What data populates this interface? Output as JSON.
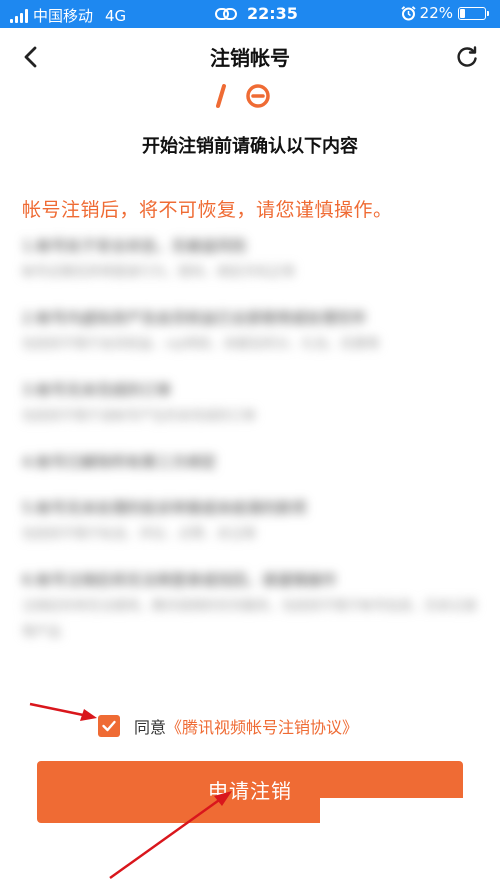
{
  "status_bar": {
    "carrier": "中国移动",
    "network": "4G",
    "time": "22:35",
    "battery_pct": "22%",
    "battery_level": 0.22
  },
  "nav": {
    "title": "注销帐号",
    "back_icon": "chevron-left-icon",
    "refresh_icon": "refresh-icon"
  },
  "subtitle": "开始注销前请确认以下内容",
  "warning": "帐号注销后，将不可恢复，请您谨慎操作。",
  "terms": [
    {
      "title": "1.帐号处于安全状态，无被盗风险",
      "desc": "帐号近期无异常登录行为，密码、绑定手机正常"
    },
    {
      "title": "2.帐号内虚拟资产及会员权益已全部使用或处理完毕",
      "desc": "包括但不限于会员权益、vip特权、余额及积分、礼包、优惠等"
    },
    {
      "title": "3.帐号无未完成的订单",
      "desc": "包括但不限于该帐号产生的未完成的订单"
    },
    {
      "title": "4.帐号已解除所有第三方绑定",
      "desc": ""
    },
    {
      "title": "5.帐号无未处理的投诉举报或未结清的款项",
      "desc": "包括但不限于私信、评论、点赞、关注等"
    },
    {
      "title": "6.帐号注销后将无法再登录或找回，请谨慎操作",
      "desc": "注销后你将无法使用，腾讯视频的任何服务，包括但不限于帐号信息、历史记录等产品"
    }
  ],
  "agreement": {
    "checked": true,
    "prefix": "同意",
    "link": "《腾讯视频帐号注销协议》"
  },
  "apply_button": "申请注销",
  "colors": {
    "status_bar": "#1e88f0",
    "accent": "#ef6b34",
    "annotation_arrow": "#d9161c"
  }
}
